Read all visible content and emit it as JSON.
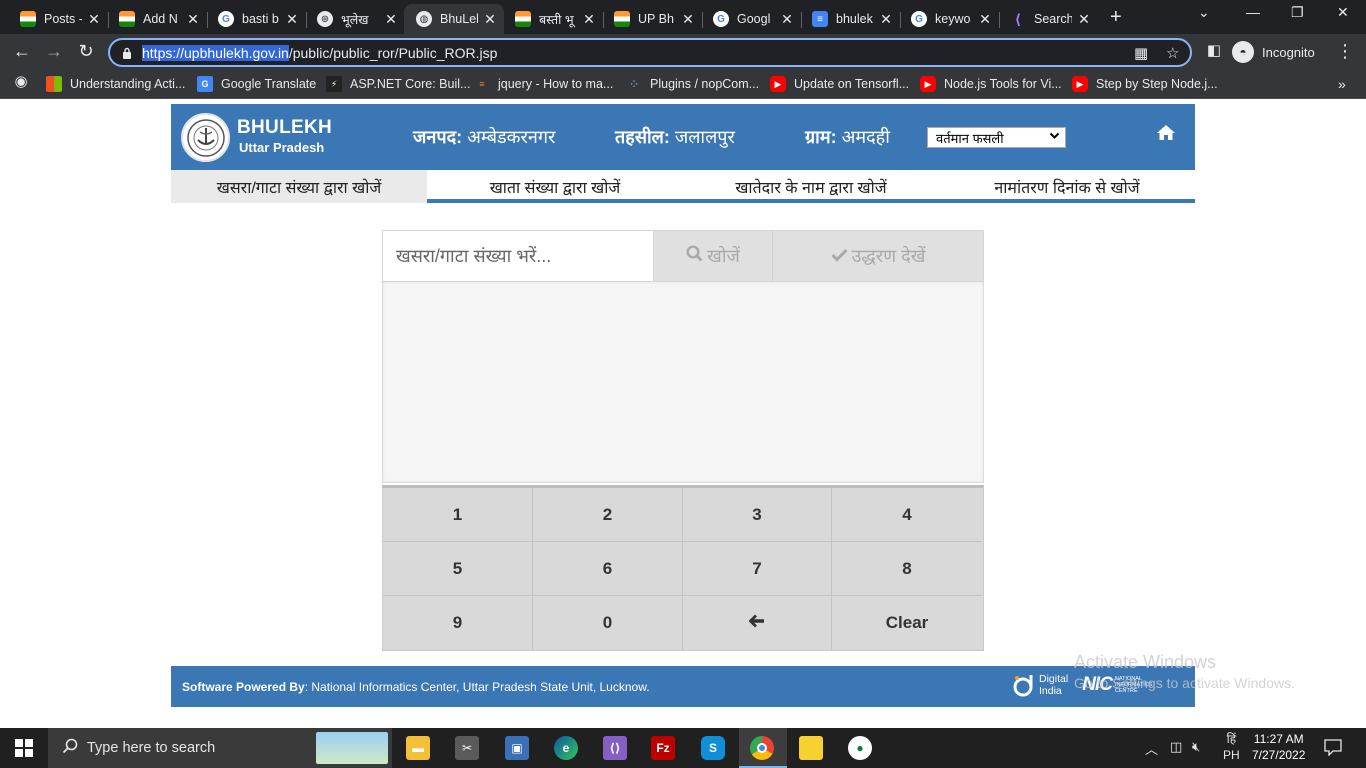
{
  "browser": {
    "tabs": [
      {
        "title": "Posts -",
        "favicon": "india-flag-icon"
      },
      {
        "title": "Add N",
        "favicon": "india-flag-icon"
      },
      {
        "title": "basti b",
        "favicon": "google-icon"
      },
      {
        "title": "भूलेख",
        "favicon": "up-emblem-icon"
      },
      {
        "title": "BhuLek",
        "favicon": "globe-icon"
      },
      {
        "title": "बस्ती भू",
        "favicon": "india-flag-icon"
      },
      {
        "title": "UP Bh",
        "favicon": "india-flag-icon"
      },
      {
        "title": "Googl",
        "favicon": "google-icon"
      },
      {
        "title": "bhulek",
        "favicon": "google-docs-icon"
      },
      {
        "title": "keywo",
        "favicon": "google-icon"
      },
      {
        "title": "Search",
        "favicon": "visual-studio-icon"
      }
    ],
    "active_tab_index": 4,
    "url_selected": "https://upbhulekh.gov.in",
    "url_rest": "/public/public_ror/Public_ROR.jsp",
    "profile_label": "Incognito",
    "bookmarks": [
      "Understanding Acti...",
      "Google Translate",
      "ASP.NET Core: Buil...",
      "jquery - How to ma...",
      "Plugins / nopCom...",
      "Update on Tensorfl...",
      "Node.js Tools for Vi...",
      "Step by Step Node.j..."
    ]
  },
  "site": {
    "brand_title": "BHULEKH",
    "brand_subtitle": "Uttar Pradesh",
    "district_label": "जनपद:",
    "district_value": "अम्बेडकरनगर",
    "tehsil_label": "तहसील:",
    "tehsil_value": "जलालपुर",
    "village_label": "ग्राम:",
    "village_value": "अमदही",
    "crop_select_value": "वर्तमान फसली",
    "nav_tabs": [
      "खसरा/गाटा संख्या द्वारा खोजें",
      "खाता संख्या द्वारा खोजें",
      "खातेदार के नाम द्वारा खोजें",
      "नामांतरण दिनांक से खोजें"
    ],
    "search_placeholder": "खसरा/गाटा संख्या भरें...",
    "search_button": "खोजें",
    "view_button": "उद्धरण देखें",
    "keypad": [
      "1",
      "2",
      "3",
      "4",
      "5",
      "6",
      "7",
      "8",
      "9",
      "0",
      "←",
      "Clear"
    ],
    "footer_label": "Software Powered By",
    "footer_text": ": National Informatics Center, Uttar Pradesh State Unit, Lucknow.",
    "digital_india_line1": "Digital",
    "digital_india_line2": "India",
    "nic_logo": "NIC",
    "nic_sub1": "NATIONAL",
    "nic_sub2": "INFORMATICS",
    "nic_sub3": "CENTRE",
    "accent_color": "#3b77b5"
  },
  "os": {
    "watermark_title": "Activate Windows",
    "watermark_sub": "Go to Settings to activate Windows.",
    "search_placeholder": "Type here to search",
    "lang_line1": "हिं",
    "lang_line2": "PH",
    "time": "11:27 AM",
    "date": "7/27/2022"
  }
}
